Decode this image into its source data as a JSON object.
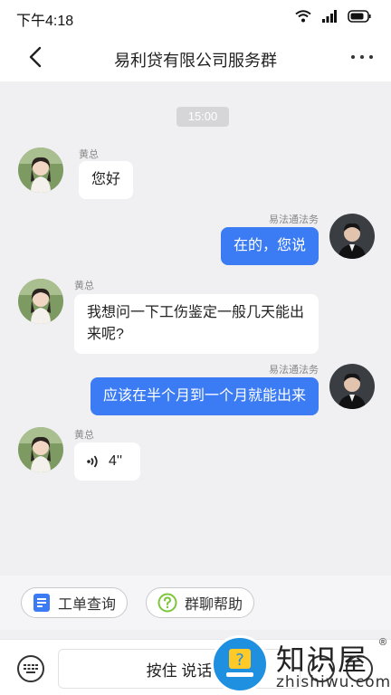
{
  "status_bar": {
    "time": "下午4:18"
  },
  "nav": {
    "title": "易利贷有限公司服务群"
  },
  "chat": {
    "time_label": "15:00",
    "messages": [
      {
        "sender": "黄总",
        "text": "您好"
      },
      {
        "sender": "易法通法务",
        "text": "在的，您说"
      },
      {
        "sender": "黄总",
        "text": "我想问一下工伤鉴定一般几天能出来呢?"
      },
      {
        "sender": "易法通法务",
        "text": "应该在半个月到一个月就能出来"
      },
      {
        "sender": "黄总",
        "voice_duration": "4''"
      }
    ]
  },
  "quick_actions": [
    {
      "label": "工单查询",
      "icon": "document-icon"
    },
    {
      "label": "群聊帮助",
      "icon": "question-icon"
    }
  ],
  "input_bar": {
    "hold_to_talk_label": "按住 说话"
  },
  "watermark": {
    "title": "知识屋",
    "reg_mark": "®",
    "domain": "zhishiwu.com",
    "logo_mark": "?"
  },
  "colors": {
    "outgoing_bubble": "#3b7cf5",
    "incoming_bubble": "#ffffff",
    "background": "#f0f0f2"
  }
}
